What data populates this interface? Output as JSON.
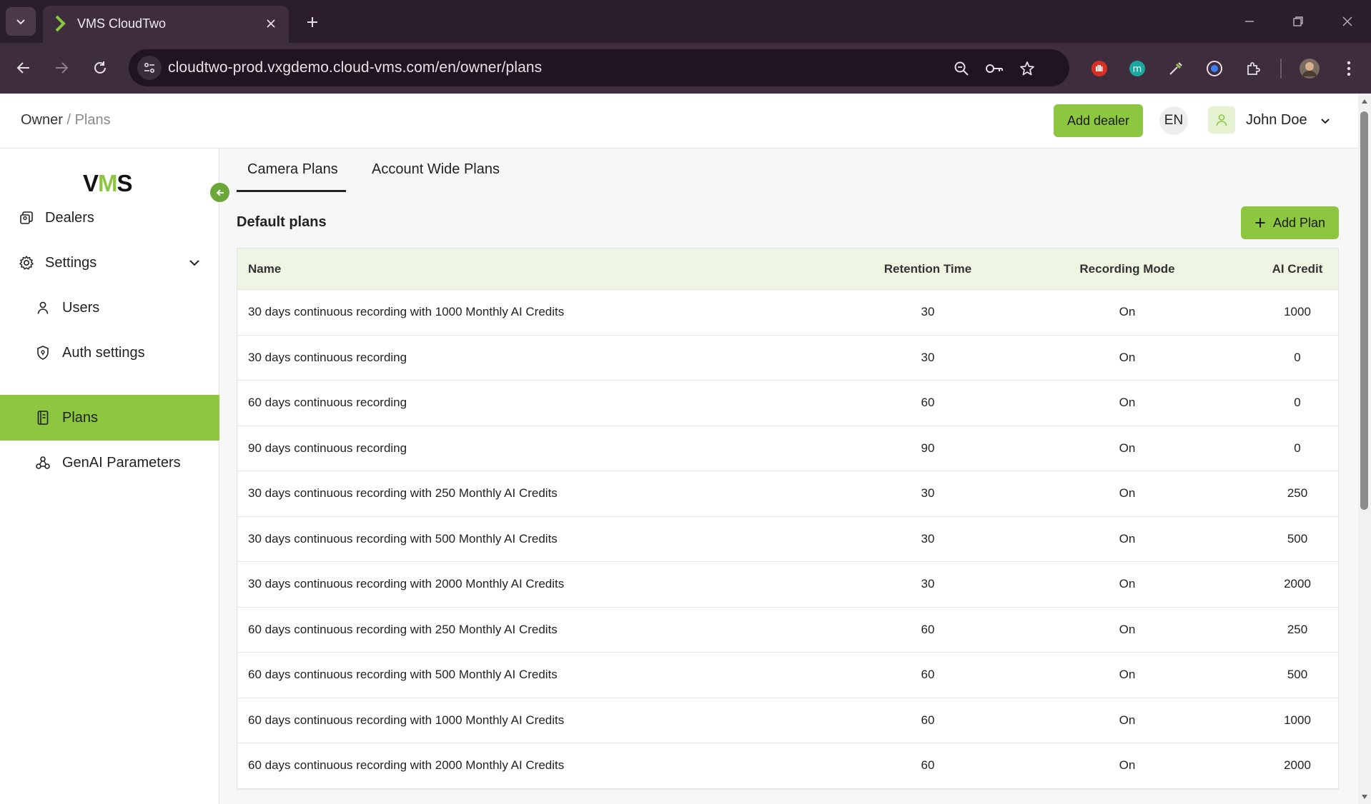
{
  "browser": {
    "tab_title": "VMS CloudTwo",
    "url": "cloudtwo-prod.vxgdemo.cloud-vms.com/en/owner/plans"
  },
  "header": {
    "breadcrumb_root": "Owner",
    "breadcrumb_sep": " / ",
    "breadcrumb_current": "Plans",
    "add_dealer_label": "Add dealer",
    "language": "EN",
    "user_name": "John Doe"
  },
  "sidebar": {
    "logo": "VMS",
    "items": [
      {
        "label": "Dealers",
        "icon": "dealers-icon"
      },
      {
        "label": "Settings",
        "icon": "gear-icon"
      },
      {
        "label": "Users",
        "icon": "user-icon"
      },
      {
        "label": "Auth settings",
        "icon": "shield-icon"
      },
      {
        "label": "Plans",
        "icon": "book-icon",
        "active": true
      },
      {
        "label": "GenAI Parameters",
        "icon": "webhook-icon"
      }
    ]
  },
  "main": {
    "tabs": [
      {
        "label": "Camera Plans",
        "active": true
      },
      {
        "label": "Account Wide Plans",
        "active": false
      }
    ],
    "section_title": "Default plans",
    "add_plan_label": "Add Plan",
    "table": {
      "columns": [
        "Name",
        "Retention Time",
        "Recording Mode",
        "AI Credit"
      ],
      "rows": [
        [
          "30 days continuous recording with 1000 Monthly AI Credits",
          "30",
          "On",
          "1000"
        ],
        [
          "30 days continuous recording",
          "30",
          "On",
          "0"
        ],
        [
          "60 days continuous recording",
          "60",
          "On",
          "0"
        ],
        [
          "90 days continuous recording",
          "90",
          "On",
          "0"
        ],
        [
          "30 days continuous recording with 250 Monthly AI Credits",
          "30",
          "On",
          "250"
        ],
        [
          "30 days continuous recording with 500 Monthly AI Credits",
          "30",
          "On",
          "500"
        ],
        [
          "30 days continuous recording with 2000 Monthly AI Credits",
          "30",
          "On",
          "2000"
        ],
        [
          "60 days continuous recording with 250 Monthly AI Credits",
          "60",
          "On",
          "250"
        ],
        [
          "60 days continuous recording with 500 Monthly AI Credits",
          "60",
          "On",
          "500"
        ],
        [
          "60 days continuous recording with 1000 Monthly AI Credits",
          "60",
          "On",
          "1000"
        ],
        [
          "60 days continuous recording with 2000 Monthly AI Credits",
          "60",
          "On",
          "2000"
        ]
      ]
    }
  },
  "colors": {
    "accent": "#8dc63f",
    "table_header_bg": "#eef5e3",
    "chrome_dark": "#2b1d2b"
  }
}
